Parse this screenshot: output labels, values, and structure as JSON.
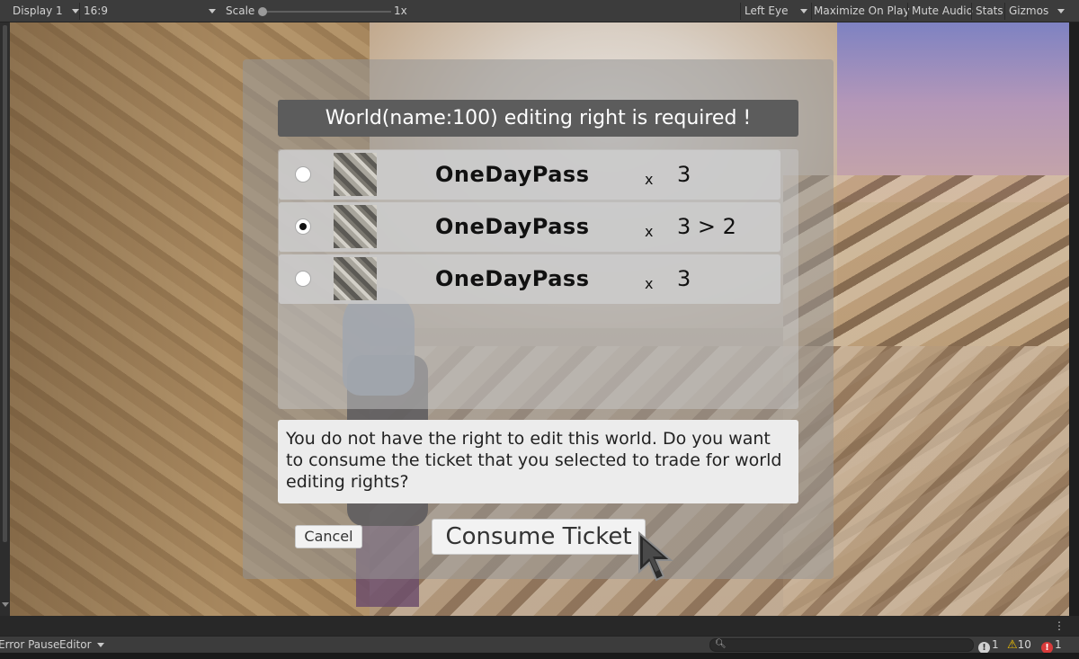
{
  "toolbar": {
    "display": "Display 1",
    "aspect": "16:9",
    "scale_label": "Scale",
    "scale_value": "1x",
    "scale_level": 0.0,
    "eye": "Left Eye",
    "maximize": "Maximize On Play",
    "mute": "Mute Audio",
    "stats": "Stats",
    "gizmos": "Gizmos"
  },
  "dialog": {
    "title": "World(name:100) editing right is required !",
    "tickets": [
      {
        "name": "OneDayPass",
        "x": "x",
        "count": "3",
        "selected": false
      },
      {
        "name": "OneDayPass",
        "x": "x",
        "count": "3 > 2",
        "selected": true
      },
      {
        "name": "OneDayPass",
        "x": "x",
        "count": "3",
        "selected": false
      }
    ],
    "message": "You do not have the right to edit this world. Do you want to consume the ticket that you selected to trade for world editing rights?",
    "cancel_label": "Cancel",
    "consume_label": "Consume Ticket"
  },
  "statusbar": {
    "error_pause": "Error Pause",
    "editor": "Editor",
    "info_count": "1",
    "warning_count": "10",
    "error_count": "1",
    "info_color": "#d0d0d0",
    "warning_color": "#f0c000",
    "error_color": "#d83a3a"
  }
}
